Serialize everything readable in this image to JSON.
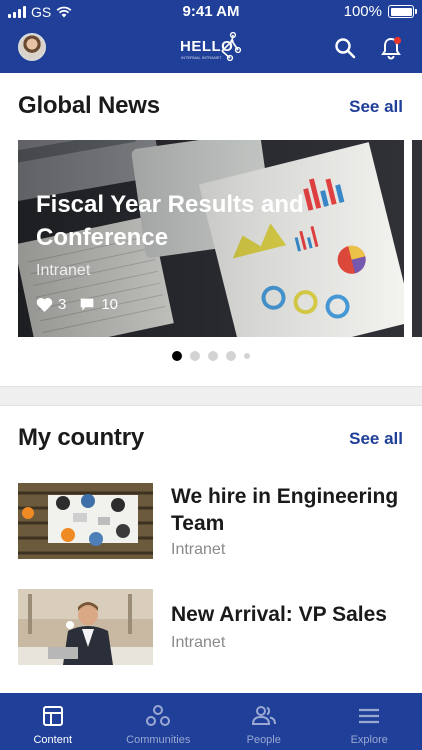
{
  "status_bar": {
    "carrier": "GS",
    "time": "9:41 AM",
    "battery": "100%"
  },
  "header": {
    "logo_text": "HELLO",
    "logo_tagline": "INTERNAL INTRANET",
    "avatar_icon": "user-avatar",
    "search_icon": "search-icon",
    "notification_icon": "bell-icon",
    "notification_badge_color": "#e8342c"
  },
  "global_news": {
    "title": "Global News",
    "see_all": "See all",
    "featured": {
      "title": "Fiscal Year Results and Conference",
      "source": "Intranet",
      "likes": "3",
      "comments": "10"
    },
    "pager": {
      "count": 5,
      "active_index": 0
    }
  },
  "my_country": {
    "title": "My country",
    "see_all": "See all",
    "articles": [
      {
        "title": "We hire in Engineering Team",
        "source": "Intranet"
      },
      {
        "title": "New Arrival: VP Sales",
        "source": "Intranet"
      }
    ]
  },
  "tabs": [
    {
      "label": "Content",
      "icon": "content-icon",
      "active": true
    },
    {
      "label": "Communities",
      "icon": "communities-icon",
      "active": false
    },
    {
      "label": "People",
      "icon": "people-icon",
      "active": false
    },
    {
      "label": "Explore",
      "icon": "menu-icon",
      "active": false
    }
  ],
  "colors": {
    "brand_blue": "#1f3f98",
    "link_blue": "#1f3f98",
    "muted_text": "#8a8a8a"
  }
}
